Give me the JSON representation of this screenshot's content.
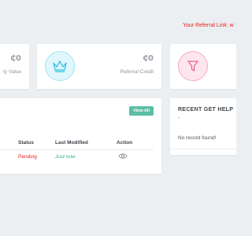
{
  "header": {
    "referral_label": "Your Referral Link: w"
  },
  "stats": [
    {
      "value": "₵0",
      "label": "ty Value"
    },
    {
      "value": "₵0",
      "label": "Referral Credit",
      "icon": "crown-icon",
      "accent": "#33c3e0"
    },
    {
      "icon": "filter-icon",
      "accent": "#ee5e88"
    }
  ],
  "table": {
    "view_all_label": "View All",
    "columns": [
      "Status",
      "Last Modified",
      "Action"
    ],
    "rows": [
      {
        "status": "Pending",
        "last_modified": "Just now",
        "action_icon": "eye-icon"
      }
    ]
  },
  "help": {
    "title": "RECENT GET HELP",
    "dash": "-",
    "empty_text": "No record found!"
  },
  "colors": {
    "background": "#eceff2",
    "referral": "#e8201a",
    "button": "#5bbfa5",
    "pending": "#e8201a",
    "just_now": "#3aaa88"
  }
}
